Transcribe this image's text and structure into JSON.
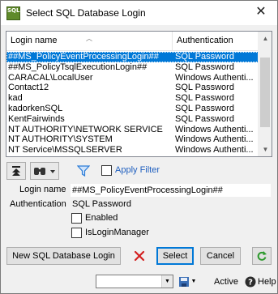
{
  "window": {
    "title": "Select SQL Database Login",
    "icon_text": "SQL",
    "close_glyph": "✕"
  },
  "grid": {
    "columns": [
      "Login name",
      "Authentication"
    ],
    "rows": [
      {
        "name": "##MS_PolicyEventProcessingLogin##",
        "auth": "SQL Password",
        "selected": true
      },
      {
        "name": "##MS_PolicyTsqlExecutionLogin##",
        "auth": "SQL Password"
      },
      {
        "name": "CARACAL\\LocalUser",
        "auth": "Windows Authenti..."
      },
      {
        "name": "Contact12",
        "auth": "SQL Password"
      },
      {
        "name": "kad",
        "auth": "SQL Password"
      },
      {
        "name": "kadorkenSQL",
        "auth": "SQL Password"
      },
      {
        "name": "KentFairwinds",
        "auth": "SQL Password"
      },
      {
        "name": "NT AUTHORITY\\NETWORK SERVICE",
        "auth": "Windows Authenti..."
      },
      {
        "name": "NT AUTHORITY\\SYSTEM",
        "auth": "Windows Authenti..."
      },
      {
        "name": "NT Service\\MSSQLSERVER",
        "auth": "Windows Authenti..."
      }
    ]
  },
  "toolbar": {
    "apply_filter_label": "Apply Filter",
    "apply_filter_checked": false
  },
  "detail": {
    "login_name_label": "Login name",
    "login_name_value": "##MS_PolicyEventProcessingLogin##",
    "authentication_label": "Authentication",
    "authentication_value": "SQL Password",
    "enabled_label": "Enabled",
    "enabled_checked": false,
    "is_login_manager_label": "IsLoginManager",
    "is_login_manager_checked": false
  },
  "buttons": {
    "new_login": "New SQL Database Login",
    "select": "Select",
    "cancel": "Cancel"
  },
  "statusbar": {
    "combo_value": "",
    "active_label": "Active",
    "help_label": "Help"
  },
  "colors": {
    "selection": "#0078d7",
    "delete_red": "#d32020",
    "refresh_green": "#2e9a2e",
    "filter_blue": "#2a7bd6"
  }
}
